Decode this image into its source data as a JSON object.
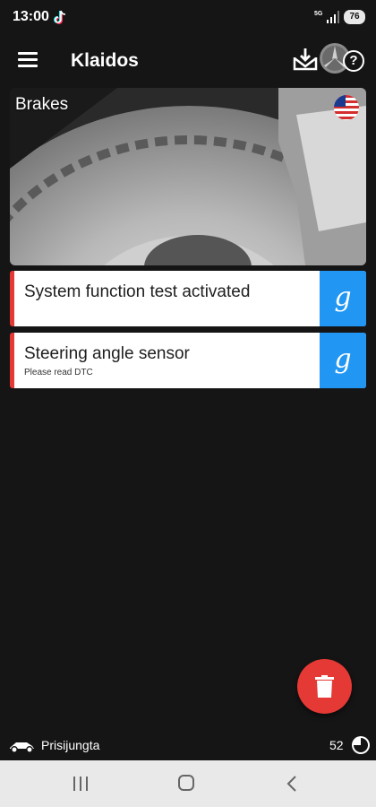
{
  "status_bar": {
    "time": "13:00",
    "network": "5G",
    "battery": "76"
  },
  "app_bar": {
    "title": "Klaidos",
    "icons": [
      "menu-icon",
      "inbox-download-icon",
      "car-brand-logo-icon",
      "help-icon"
    ]
  },
  "hero": {
    "title": "Brakes",
    "flag": "us-flag-icon"
  },
  "results": [
    {
      "title": "System function test activated",
      "subtitle": "",
      "action_label": "g"
    },
    {
      "title": "Steering angle sensor",
      "subtitle": "Please read DTC",
      "action_label": "g"
    }
  ],
  "fab": {
    "icon": "trash-icon",
    "color": "#e53935"
  },
  "bottom_status": {
    "connection_label": "Prisijungta",
    "count": "52"
  },
  "colors": {
    "background": "#151515",
    "accent_red": "#e53935",
    "accent_blue": "#2196f3"
  }
}
